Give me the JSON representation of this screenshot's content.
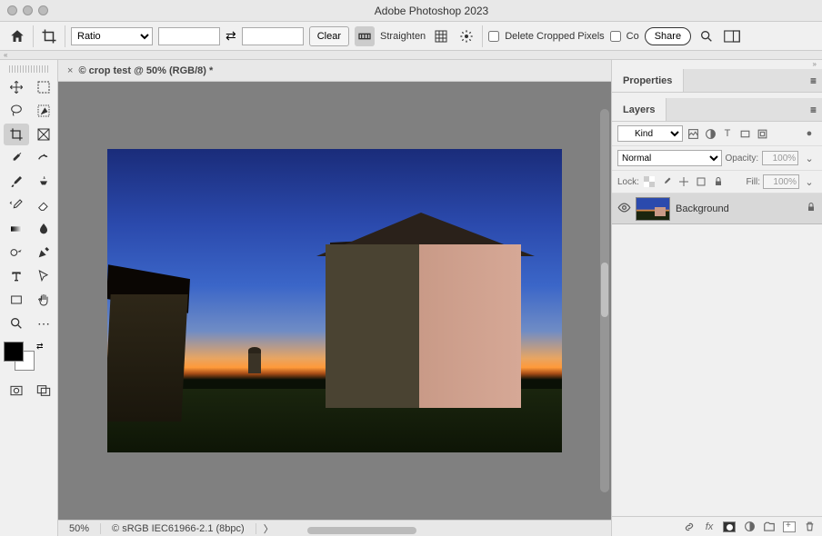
{
  "app": {
    "title": "Adobe Photoshop 2023"
  },
  "options": {
    "ratio_mode": "Ratio",
    "width": "",
    "height": "",
    "clear_label": "Clear",
    "straighten_label": "Straighten",
    "delete_cropped_label": "Delete Cropped Pixels",
    "content_aware_short": "Co",
    "share_label": "Share"
  },
  "document": {
    "tab_title": "© crop test @ 50% (RGB/8) *",
    "zoom": "50%",
    "color_profile": "© sRGB IEC61966-2.1 (8bpc)"
  },
  "panels": {
    "properties_tab": "Properties",
    "layers_tab": "Layers",
    "layers": {
      "kind_label": "Kind",
      "blend_mode": "Normal",
      "opacity_label": "Opacity:",
      "opacity_value": "100%",
      "lock_label": "Lock:",
      "fill_label": "Fill:",
      "fill_value": "100%",
      "items": [
        {
          "name": "Background",
          "visible": true,
          "locked": true
        }
      ]
    }
  }
}
